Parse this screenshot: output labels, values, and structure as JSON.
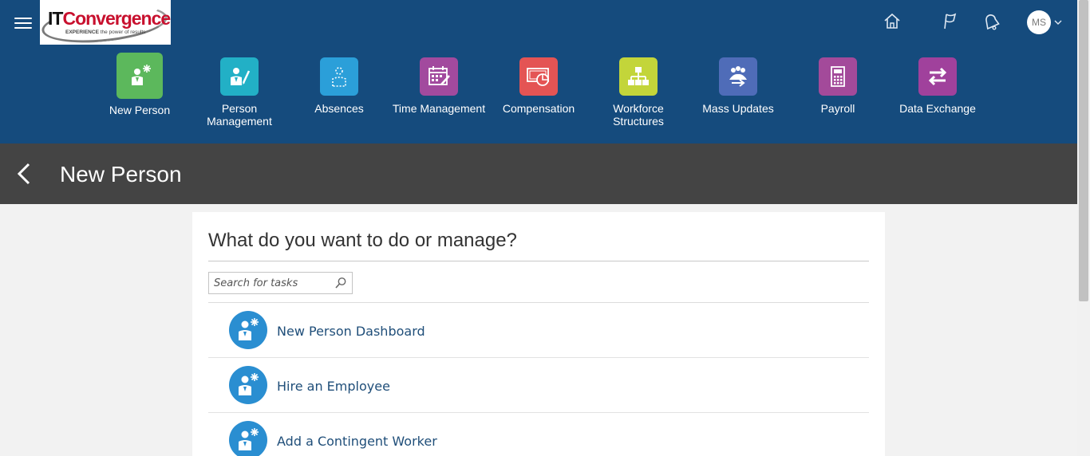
{
  "logo": {
    "it": "IT",
    "convergence": "Convergence",
    "tagline_bold": "EXPERIENCE",
    "tagline_rest": " the power of results"
  },
  "toolbar": {
    "user_initials": "MS"
  },
  "springboard": [
    {
      "label": "New Person",
      "color": "#5cb85c",
      "icon": "new-person-icon"
    },
    {
      "label": "Person Management",
      "color": "#22b0c6",
      "icon": "person-management-icon"
    },
    {
      "label": "Absences",
      "color": "#2b9fd9",
      "icon": "absences-icon"
    },
    {
      "label": "Time Management",
      "color": "#a24a9e",
      "icon": "calendar-icon"
    },
    {
      "label": "Compensation",
      "color": "#e45454",
      "icon": "compensation-icon"
    },
    {
      "label": "Workforce Structures",
      "color": "#c3d53a",
      "icon": "org-chart-icon"
    },
    {
      "label": "Mass Updates",
      "color": "#4f6cb8",
      "icon": "mass-updates-icon"
    },
    {
      "label": "Payroll",
      "color": "#a34a9a",
      "icon": "calculator-icon"
    },
    {
      "label": "Data Exchange",
      "color": "#a0419c",
      "icon": "data-exchange-icon"
    }
  ],
  "page": {
    "title": "New Person"
  },
  "main": {
    "question": "What do you want to do or manage?",
    "search_placeholder": "Search for tasks",
    "tasks": [
      {
        "label": "New Person Dashboard",
        "icon": "new-person-icon"
      },
      {
        "label": "Hire an Employee",
        "icon": "new-person-icon"
      },
      {
        "label": "Add a Contingent Worker",
        "icon": "new-person-icon"
      }
    ]
  }
}
